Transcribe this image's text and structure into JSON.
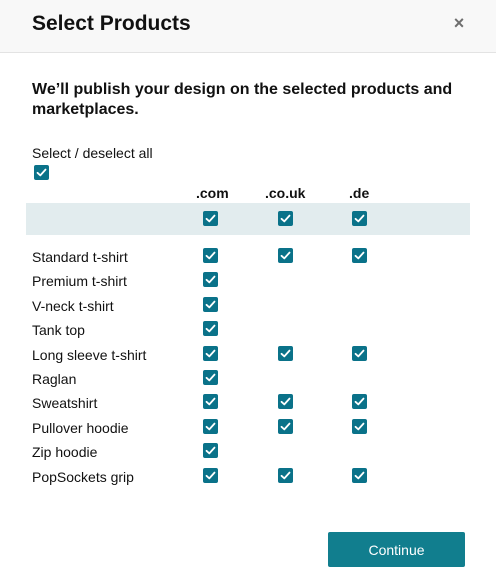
{
  "dialog": {
    "title": "Select Products",
    "close_glyph": "×",
    "intro": "We’ll publish your design on the selected products and marketplaces.",
    "select_all_label": "Select / deselect all",
    "select_all_checked": true,
    "continue_label": "Continue"
  },
  "marketplaces": [
    {
      "label": ".com",
      "all_checked": true
    },
    {
      "label": ".co.uk",
      "all_checked": true
    },
    {
      "label": ".de",
      "all_checked": true
    }
  ],
  "products": [
    {
      "name": "Standard t-shirt",
      "checks": [
        true,
        true,
        true
      ]
    },
    {
      "name": "Premium t-shirt",
      "checks": [
        true,
        null,
        null
      ]
    },
    {
      "name": "V-neck t-shirt",
      "checks": [
        true,
        null,
        null
      ]
    },
    {
      "name": "Tank top",
      "checks": [
        true,
        null,
        null
      ]
    },
    {
      "name": "Long sleeve t-shirt",
      "checks": [
        true,
        true,
        true
      ]
    },
    {
      "name": "Raglan",
      "checks": [
        true,
        null,
        null
      ]
    },
    {
      "name": "Sweatshirt",
      "checks": [
        true,
        true,
        true
      ]
    },
    {
      "name": "Pullover hoodie",
      "checks": [
        true,
        true,
        true
      ]
    },
    {
      "name": "Zip hoodie",
      "checks": [
        true,
        null,
        null
      ]
    },
    {
      "name": "PopSockets grip",
      "checks": [
        true,
        true,
        true
      ]
    }
  ],
  "colors": {
    "checkbox": "#0a7289",
    "button": "#117e8e",
    "band": "#e2ecee"
  },
  "icons": {
    "checkbox": "checkmark-icon",
    "close": "close-icon"
  }
}
